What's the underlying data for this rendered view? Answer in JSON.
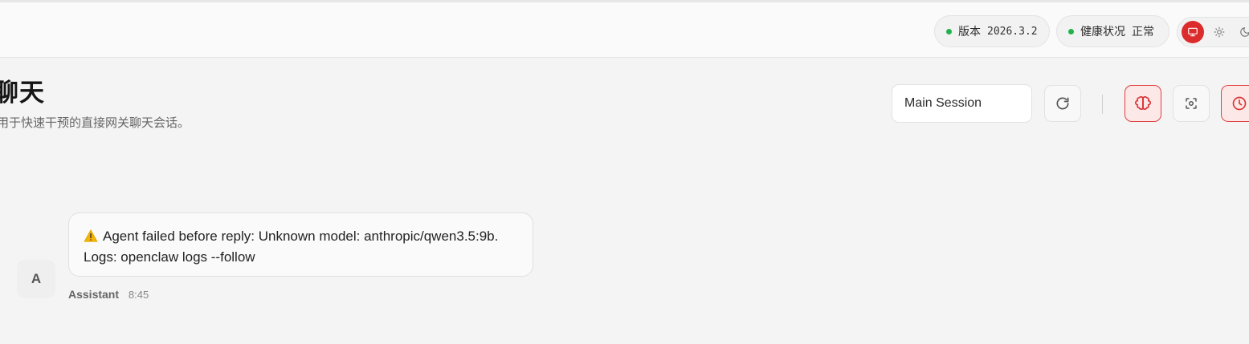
{
  "header": {
    "version_label": "版本",
    "version_value": "2026.3.2",
    "health_label": "健康状况",
    "health_value": "正常",
    "status_color": "#22b24c",
    "accent_color": "#dc2b2b"
  },
  "theme": {
    "options": [
      "monitor-icon",
      "sun-icon",
      "moon-icon"
    ],
    "selected": "monitor-icon"
  },
  "page": {
    "title": "聊天",
    "subtitle": "用于快速干预的直接网关聊天会话。"
  },
  "toolbar": {
    "session_value": "Main Session",
    "buttons": [
      "refresh-icon",
      "brain-icon",
      "focus-icon",
      "clock-icon"
    ]
  },
  "chat": {
    "messages": [
      {
        "avatar": "A",
        "line1": "Agent failed before reply: Unknown model: anthropic/qwen3.5:9b.",
        "line2": "Logs: openclaw logs --follow",
        "sender": "Assistant",
        "time": "8:45",
        "icon": "warning-icon"
      }
    ]
  }
}
